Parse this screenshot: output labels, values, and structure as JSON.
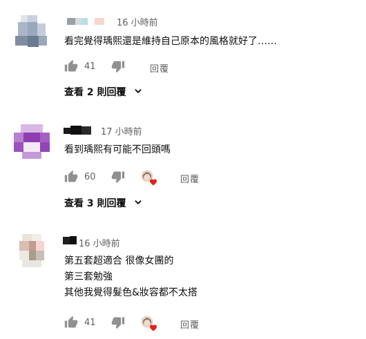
{
  "comments": [
    {
      "time": "16 小時前",
      "lines": [
        "看完覺得瑀熙還是維持自己原本的風格就好了……"
      ],
      "likes": "41",
      "reply_label": "回覆",
      "has_creator_heart": false,
      "view_replies": {
        "prefix": "查看",
        "count": "2",
        "suffix": "則回覆"
      }
    },
    {
      "time": "17 小時前",
      "lines": [
        "看到瑀熙有可能不回頭嗎"
      ],
      "likes": "60",
      "reply_label": "回覆",
      "has_creator_heart": true,
      "view_replies": {
        "prefix": "查看",
        "count": "3",
        "suffix": "則回覆"
      }
    },
    {
      "time": "16 小時前",
      "lines": [
        "第五套超適合 很像女團的",
        "第三套勉強",
        "其他我覺得髮色&妝容都不太搭"
      ],
      "likes": "41",
      "reply_label": "回覆",
      "has_creator_heart": true
    }
  ],
  "colors": {
    "heart": "#e62117",
    "muted": "#606060",
    "text": "#0f0f0f"
  },
  "icons": [
    "thumb-up-icon",
    "thumb-down-icon",
    "chevron-down-icon",
    "heart-icon"
  ]
}
